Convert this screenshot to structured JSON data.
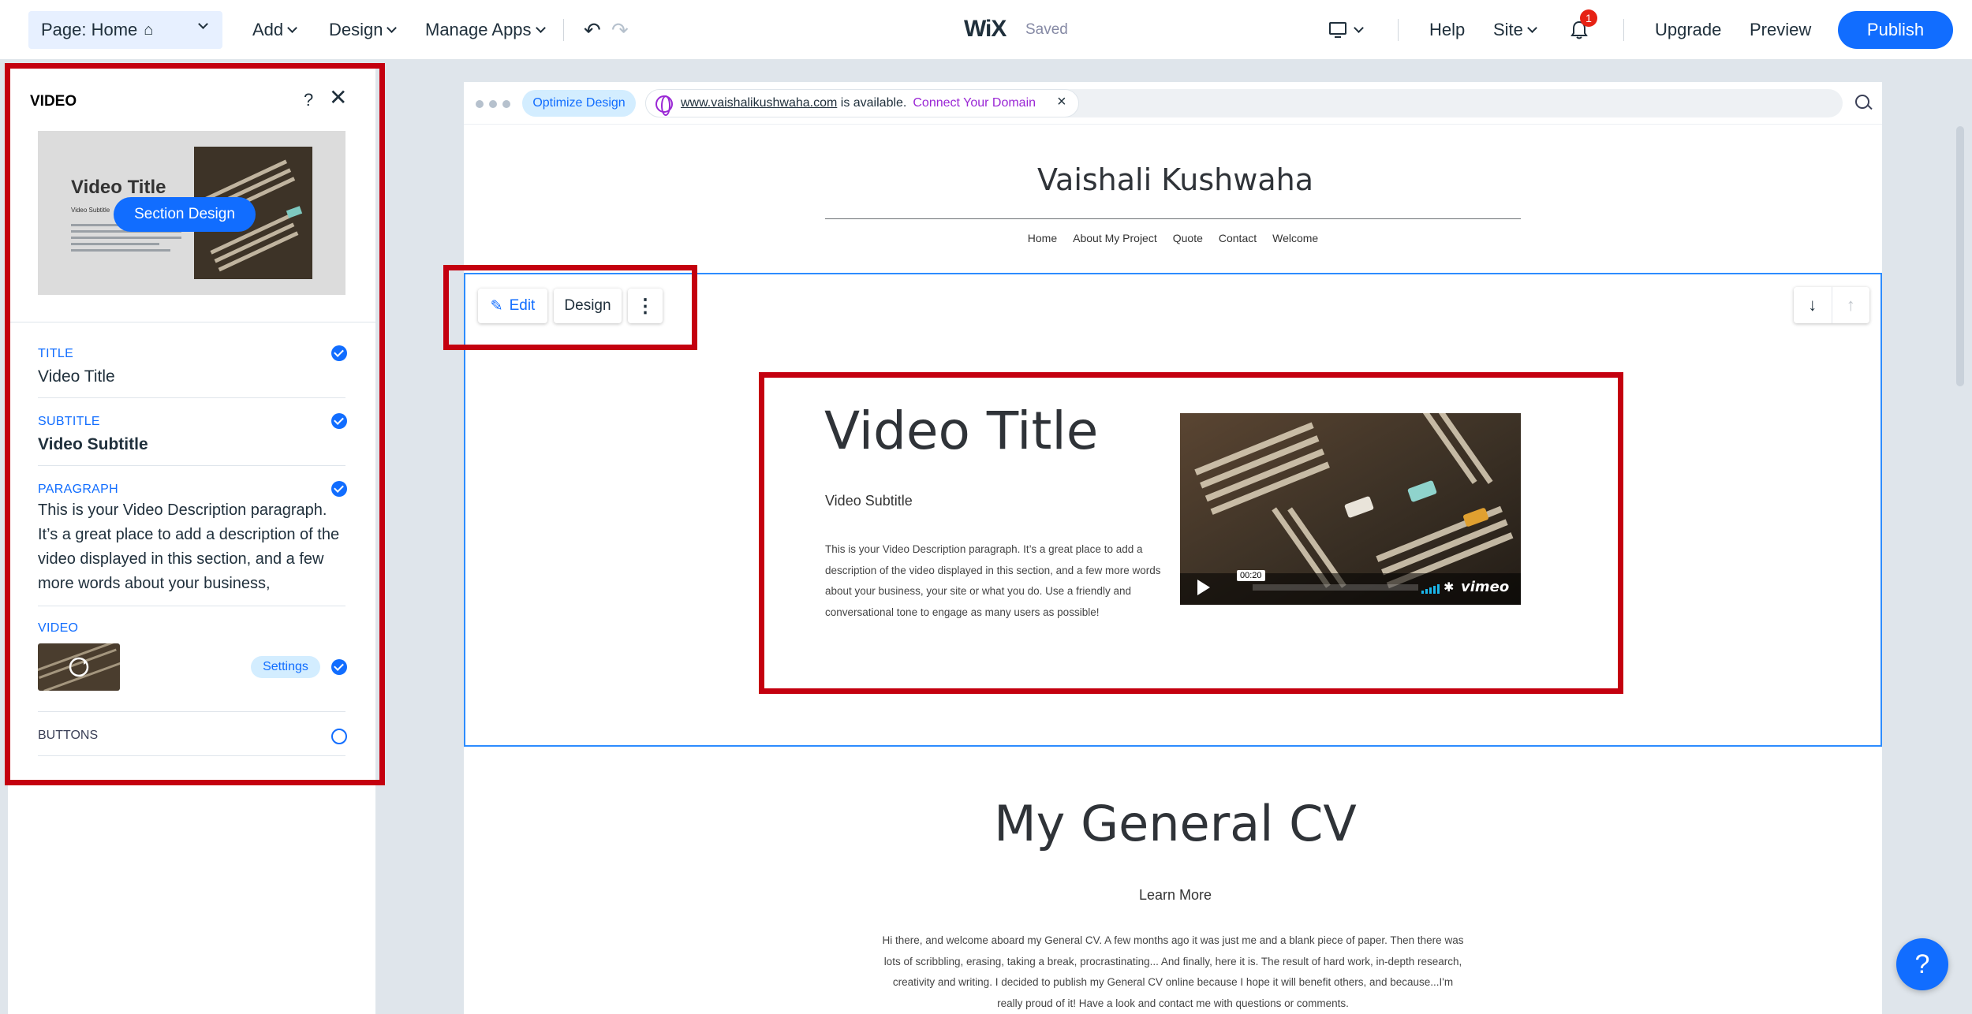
{
  "topbar": {
    "page_selector": "Page: Home",
    "add": "Add",
    "design": "Design",
    "manage_apps": "Manage Apps",
    "logo": "WiX",
    "status": "Saved",
    "help": "Help",
    "site": "Site",
    "notification_count": "1",
    "upgrade": "Upgrade",
    "preview": "Preview",
    "publish": "Publish"
  },
  "panel": {
    "title": "VIDEO",
    "help": "?",
    "thumb_title": "Video Title",
    "thumb_subtitle": "Video Subtitle",
    "section_design": "Section Design",
    "fields": {
      "title_label": "TITLE",
      "title_value": "Video Title",
      "subtitle_label": "SUBTITLE",
      "subtitle_value": "Video Subtitle",
      "paragraph_label": "PARAGRAPH",
      "paragraph_value": "This is your Video Description paragraph. It’s a great place to add a description of the video displayed in this section, and a few more words about your business,",
      "video_label": "VIDEO",
      "settings": "Settings",
      "buttons_label": "BUTTONS"
    }
  },
  "browser": {
    "optimize": "Optimize Design",
    "domain": "www.vaishalikushwaha.com",
    "available": " is available.",
    "connect": "Connect Your Domain",
    "close": "×"
  },
  "site": {
    "name": "Vaishali Kushwaha",
    "nav": [
      "Home",
      "About My Project",
      "Quote",
      "Contact",
      "Welcome"
    ],
    "toolbar": {
      "edit": "Edit",
      "design": "Design",
      "more": "⋮"
    },
    "video_section": {
      "title": "Video Title",
      "subtitle": "Video Subtitle",
      "description": "This is your Video Description paragraph. It’s a great place to add a description of the video displayed in this section, and a few more words about your business, your site or what you do. Use a friendly and conversational tone to engage as many users as possible!",
      "player_time": "00:20",
      "player_brand": "vimeo"
    },
    "cv_section": {
      "title": "My General CV",
      "link": "Learn More",
      "text": "Hi there, and welcome aboard my General CV. A few months ago it was just me and a blank piece of paper. Then there was lots of scribbling, erasing, taking a break, procrastinating... And finally, here it is. The result of hard work, in-depth research, creativity and writing. I decided to publish my General CV online because I hope it will benefit others, and because...I'm really proud of it! Have a look and contact me with questions or comments."
    }
  },
  "help_bubble": "?",
  "colors": {
    "accent": "#116dff",
    "annotation": "#c4000f",
    "selection": "#2d8cff"
  }
}
